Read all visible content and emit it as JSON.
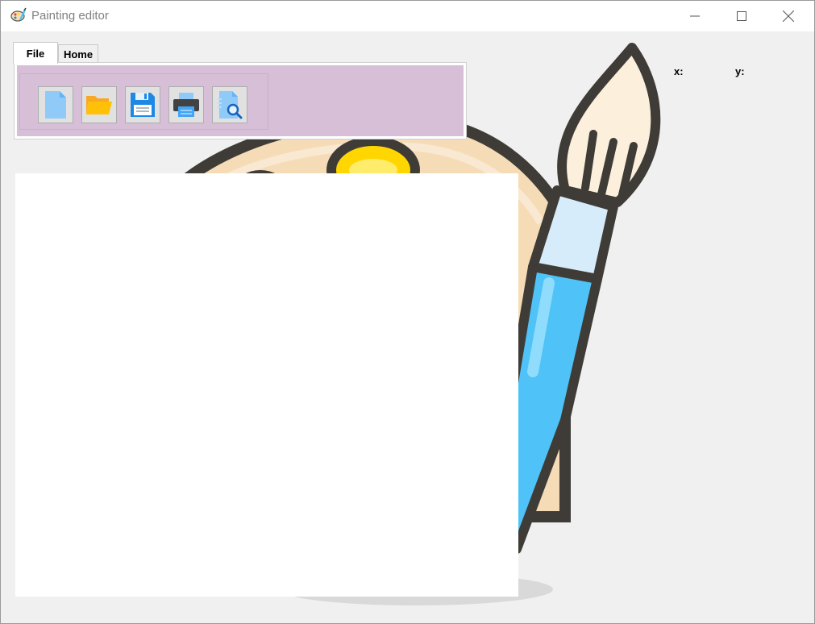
{
  "window": {
    "title": "Painting editor"
  },
  "tabs": [
    {
      "label": "File",
      "selected": true
    },
    {
      "label": "Home",
      "selected": false
    }
  ],
  "toolbar": {
    "buttons": [
      {
        "icon": "new-file-icon"
      },
      {
        "icon": "open-folder-icon"
      },
      {
        "icon": "save-icon"
      },
      {
        "icon": "print-icon"
      },
      {
        "icon": "print-preview-icon"
      }
    ]
  },
  "coordinates": {
    "x_label": "x:",
    "y_label": "y:"
  },
  "colors": {
    "ribbon_bg": "#d8bfd8",
    "brush_blue": "#4fc3f7"
  }
}
